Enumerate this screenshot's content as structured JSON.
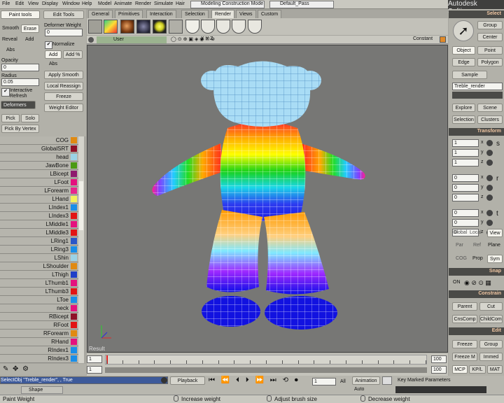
{
  "app": {
    "brand": "Autodesk Softimage"
  },
  "menu": [
    "File",
    "Edit",
    "View",
    "Display",
    "Window",
    "Help",
    "Model",
    "Animate",
    "Render",
    "Simulate",
    "Hair"
  ],
  "mode_selector": "Modeling Construction Mode",
  "pass_selector": "Default_Pass",
  "top_tabs": [
    "General",
    "Primitives",
    "Interaction",
    "Selection",
    "Render",
    "Views",
    "Custom"
  ],
  "left_panel": {
    "tab_paint": "Paint tools",
    "tab_edit": "Edit Tools",
    "smooth": "Smooth",
    "erase": "Erase",
    "reveal": "Reveal",
    "add": "Add",
    "abs": "Abs",
    "opacity_label": "Opacity",
    "opacity_value": "0",
    "radius_label": "Radius",
    "radius_value": "0.05",
    "interactive_refresh": "Interactive Refresh",
    "deformers": "Deformers",
    "pick": "Pick",
    "solo": "Solo",
    "pick_by_vertex": "Pick By Vertex",
    "deformer_weight_label": "Deformer Weight",
    "deformer_weight_value": "0",
    "normalize": "Normalize",
    "add2": "Add",
    "add_pct": "Add %",
    "abs2": "Abs",
    "apply_smooth": "Apply Smooth",
    "local_reassign": "Local Reassign",
    "freeze": "Freeze",
    "weight_editor": "Weight Editor"
  },
  "joints": [
    {
      "name": "COG",
      "color": "#e08a12"
    },
    {
      "name": "GlobalSRT",
      "color": "#8f1027"
    },
    {
      "name": "head",
      "color": "#9bd3e6"
    },
    {
      "name": "JawBone",
      "color": "#4b9a12"
    },
    {
      "name": "LBicept",
      "color": "#8e1a6e"
    },
    {
      "name": "LFoot",
      "color": "#e4117e"
    },
    {
      "name": "LForearm",
      "color": "#e6268c"
    },
    {
      "name": "LHand",
      "color": "#f2f25a"
    },
    {
      "name": "LIndex1",
      "color": "#1a8ee8"
    },
    {
      "name": "LIndex3",
      "color": "#e21414"
    },
    {
      "name": "LMiddle1",
      "color": "#e4117e"
    },
    {
      "name": "LMiddle3",
      "color": "#e21414"
    },
    {
      "name": "LRing1",
      "color": "#2a56c8"
    },
    {
      "name": "LRing3",
      "color": "#1a8ee8"
    },
    {
      "name": "LShin",
      "color": "#9bd3e6"
    },
    {
      "name": "LShoulder",
      "color": "#e08a12"
    },
    {
      "name": "LThigh",
      "color": "#2040c8"
    },
    {
      "name": "LThumb1",
      "color": "#e4117e"
    },
    {
      "name": "LThumb3",
      "color": "#e21414"
    },
    {
      "name": "LToe",
      "color": "#1a8ee8"
    },
    {
      "name": "neck",
      "color": "#e4117e"
    },
    {
      "name": "RBicept",
      "color": "#8f1027"
    },
    {
      "name": "RFoot",
      "color": "#e21414"
    },
    {
      "name": "RForearm",
      "color": "#e08a12"
    },
    {
      "name": "RHand",
      "color": "#e4117e"
    },
    {
      "name": "RIndex1",
      "color": "#1a8ee8"
    },
    {
      "name": "RIndex3",
      "color": "#1a8ee8"
    }
  ],
  "viewport": {
    "camera": "User",
    "axes": "X Y Z",
    "shading": "Constant",
    "result_label": "Result"
  },
  "right_panel": {
    "select_header": "Select",
    "group": "Group",
    "center": "Center",
    "object": "Object",
    "point": "Point",
    "edge": "Edge",
    "polygon": "Polygon",
    "sample": "Sample",
    "selected_name": "Treble_render",
    "explore": "Explore",
    "scene": "Scene",
    "selection": "Selection",
    "clusters": "Clusters",
    "transform_header": "Transform",
    "rows": [
      {
        "value": "1",
        "axis": "x",
        "tag": "s"
      },
      {
        "value": "1",
        "axis": "y",
        "tag": ""
      },
      {
        "value": "1",
        "axis": "z",
        "tag": ""
      },
      {
        "value": "0",
        "axis": "x",
        "tag": "r"
      },
      {
        "value": "0",
        "axis": "y",
        "tag": ""
      },
      {
        "value": "0",
        "axis": "z",
        "tag": ""
      },
      {
        "value": "0",
        "axis": "x",
        "tag": "t"
      },
      {
        "value": "0",
        "axis": "y",
        "tag": ""
      },
      {
        "value": "0",
        "axis": "z",
        "tag": ""
      }
    ],
    "global": "Global",
    "local": "Local",
    "view": "View",
    "par": "Par",
    "ref": "Ref",
    "plane": "Plane",
    "cog": "COG",
    "prop": "Prop",
    "sym": "Sym",
    "snap_header": "Snap",
    "on": "ON",
    "constrain_header": "Constrain",
    "parent": "Parent",
    "cut": "Cut",
    "cnscomp": "CnsComp",
    "childcomp": "ChildComp",
    "edit_header": "Edit",
    "freeze": "Freeze",
    "group2": "Group",
    "freeze_m": "Freeze M",
    "immed": "Immed",
    "mcp": "MCP",
    "kpl": "KP/L",
    "mat": "MAT"
  },
  "timeline": {
    "start": "1",
    "end": "100",
    "end2": "100",
    "ticks": [
      "1",
      "5",
      "10",
      "15",
      "20",
      "25",
      "30",
      "35",
      "40",
      "45",
      "50",
      "55",
      "60",
      "65",
      "70",
      "75",
      "80",
      "85",
      "90",
      "95",
      "100"
    ],
    "playback": "Playback",
    "frame": "1",
    "all": "All",
    "animation": "Animation",
    "auto": "Auto",
    "key_marked": "Key Marked Parameters"
  },
  "command_line": "SelectObj \"Treble_render\", , True",
  "shape_manager_tab": "Shape Manager",
  "status": {
    "tool": "Paint Weight",
    "l": "Increase weight",
    "m": "Adjust brush size",
    "r": "Decrease weight"
  }
}
